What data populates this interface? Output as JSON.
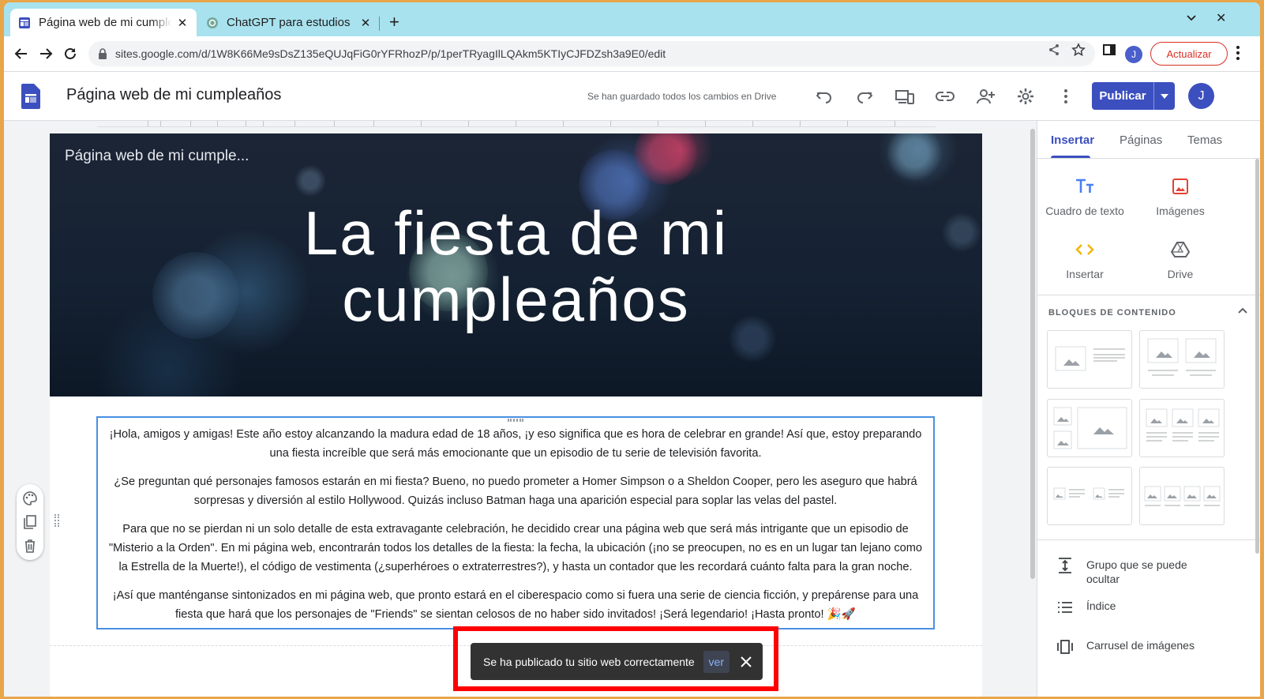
{
  "browser": {
    "tabs": [
      {
        "title": "Página web de mi cumpleaños",
        "active": true
      },
      {
        "title": "ChatGPT para estudios",
        "active": false
      }
    ],
    "url": "sites.google.com/d/1W8K66Me9sDsZ135eQUJqFiG0rYFRhozP/p/1perTRyagIlLQAkm5KTIyCJFDZsh3a9E0/edit",
    "profile_initial": "J",
    "update_label": "Actualizar"
  },
  "sites": {
    "title": "Página web de mi cumpleaños",
    "save_status": "Se han guardado todos los cambios en Drive",
    "publish_label": "Publicar",
    "avatar_initial": "J"
  },
  "page": {
    "header_site_name": "Página web de mi cumple...",
    "hero_title_line1": "La fiesta de mi",
    "hero_title_line2": "cumpleaños",
    "paragraphs": [
      "¡Hola, amigos y amigas! Este año estoy alcanzando la madura edad de 18 años, ¡y eso significa que es hora de celebrar en grande! Así que, estoy preparando una fiesta increíble que será más emocionante que un episodio de tu serie de televisión favorita.",
      "¿Se preguntan qué personajes famosos estarán en mi fiesta? Bueno, no puedo prometer a Homer Simpson o a Sheldon Cooper, pero les aseguro que habrá sorpresas y diversión al estilo Hollywood. Quizás incluso Batman haga una aparición especial para soplar las velas del pastel.",
      "Para que no se pierdan ni un solo detalle de esta extravagante celebración, he decidido crear una página web que será más intrigante que un episodio de \"Misterio a la Orden\". En mi página web, encontrarán todos los detalles de la fiesta: la fecha, la ubicación (¡no se preocupen, no es en un lugar tan lejano como la Estrella de la Muerte!), el código de vestimenta (¿superhéroes o extraterrestres?), y hasta un contador que les recordará cuánto falta para la gran noche.",
      "¡Así que manténganse sintonizados en mi página web, que pronto estará en el ciberespacio como si fuera una serie de ciencia ficción, y prepárense para una fiesta que hará que los personajes de \"Friends\" se sientan celosos de no haber sido invitados! ¡Será legendario! ¡Hasta pronto! 🎉🚀"
    ]
  },
  "panel": {
    "tabs": [
      "Insertar",
      "Páginas",
      "Temas"
    ],
    "tools": [
      {
        "label": "Cuadro de texto",
        "icon": "text-box-icon"
      },
      {
        "label": "Imágenes",
        "icon": "image-icon"
      },
      {
        "label": "Insertar",
        "icon": "embed-code-icon"
      },
      {
        "label": "Drive",
        "icon": "drive-icon"
      }
    ],
    "blocks_header": "BLOQUES DE CONTENIDO",
    "items": [
      {
        "label": "Grupo que se puede ocultar",
        "icon": "collapsible-group-icon"
      },
      {
        "label": "Índice",
        "icon": "table-of-contents-icon"
      },
      {
        "label": "Carrusel de imágenes",
        "icon": "image-carousel-icon"
      }
    ]
  },
  "snackbar": {
    "message": "Se ha publicado tu sitio web correctamente",
    "action": "ver"
  },
  "colors": {
    "accent": "#3c4fbf",
    "highlight_frame": "#ff0000",
    "tabstrip": "#a8e2ee"
  }
}
